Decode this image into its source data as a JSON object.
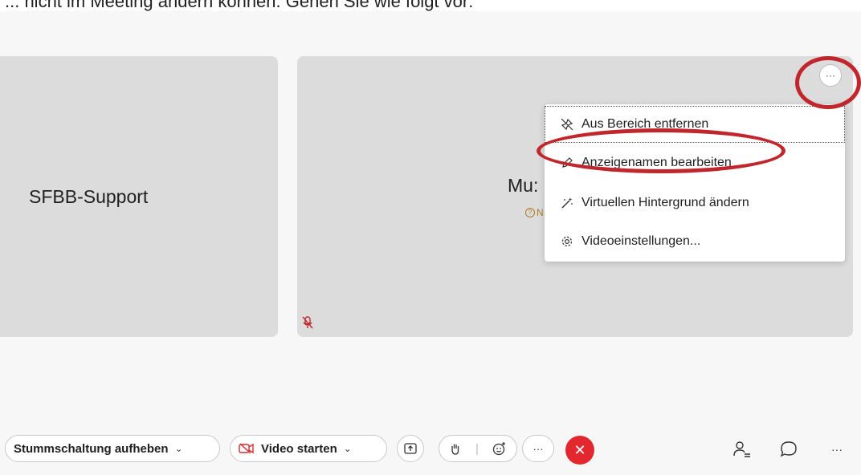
{
  "top_caption": "... nicht im Meeting ändern können. Gehen Sie wie folgt vor:",
  "tiles": {
    "left_name": "SFBB-Support",
    "right_name": "Mu:",
    "right_status": "N"
  },
  "more_button": {
    "label": "···"
  },
  "menu": {
    "items": [
      {
        "label": "Aus Bereich entfernen",
        "icon": "unpin-icon"
      },
      {
        "label": "Anzeigenamen bearbeiten",
        "icon": "pencil-icon"
      },
      {
        "label": "Virtuellen Hintergrund ändern",
        "icon": "magic-wand-icon"
      },
      {
        "label": "Videoeinstellungen...",
        "icon": "gear-icon"
      }
    ]
  },
  "toolbar": {
    "unmute_label": "Stummschaltung aufheben",
    "video_label": "Video starten",
    "more_label": "···",
    "end_label": "✕",
    "overflow_label": "···"
  },
  "colors": {
    "annotation_ring": "#c0262b",
    "end_call": "#e3272e",
    "status": "#b07a24",
    "tile": "#dcdcdc"
  }
}
